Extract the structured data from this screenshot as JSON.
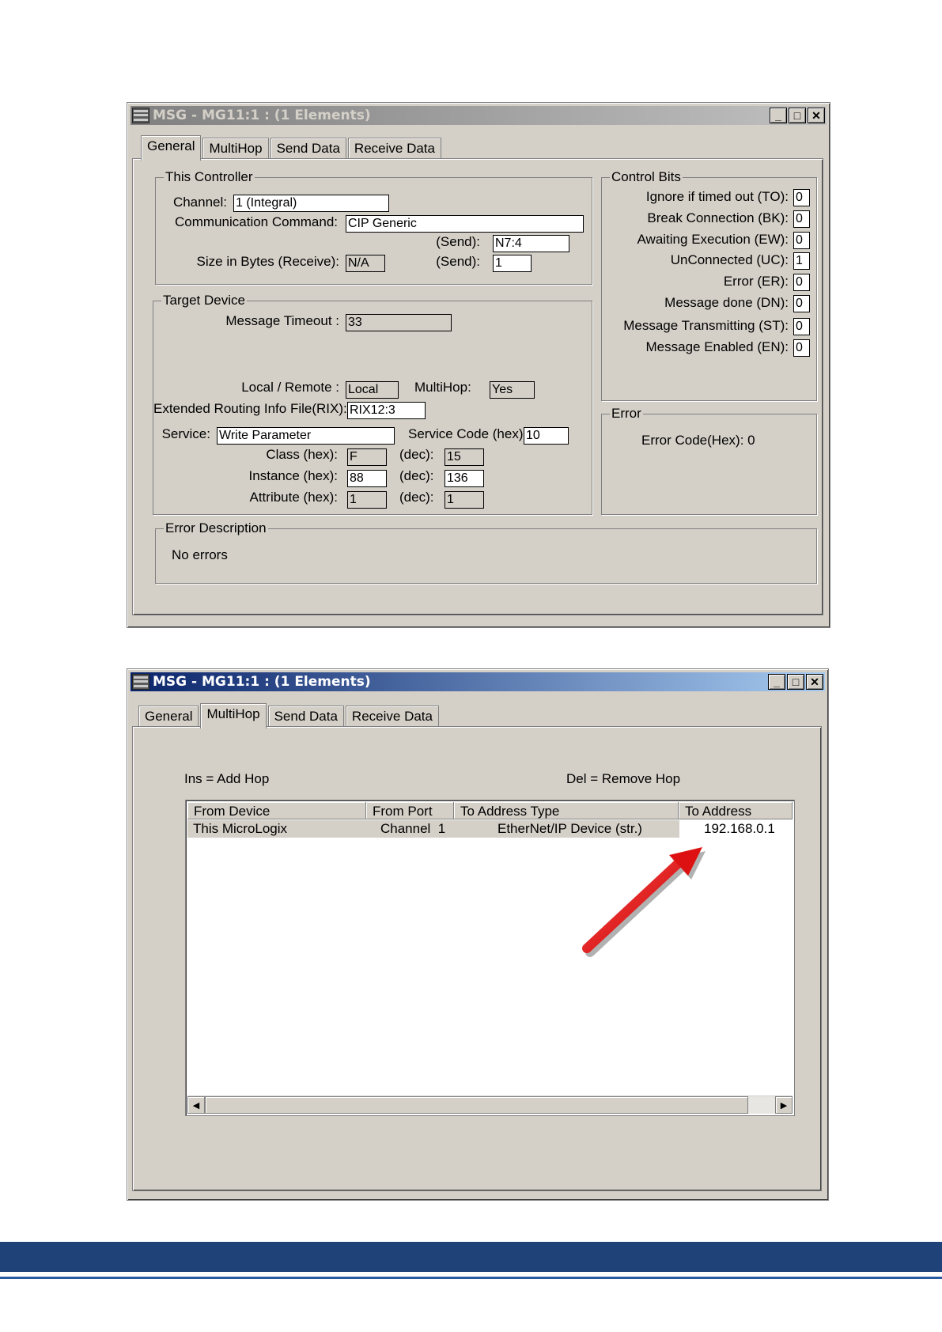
{
  "colors": {
    "footer_band": "#1f4278",
    "footer_line": "#2a5aa0",
    "arrow": "#dd1111"
  },
  "window1": {
    "title": "MSG - MG11:1 : (1 Elements)",
    "tabs": [
      "General",
      "MultiHop",
      "Send Data",
      "Receive Data"
    ],
    "active_tab": "General",
    "this_controller": {
      "legend": "This Controller",
      "channel_label": "Channel:",
      "channel_value": "1 (Integral)",
      "comm_label": "Communication Command:",
      "comm_value": "CIP Generic",
      "send_label": "(Send):",
      "send_value": "N7:4",
      "size_label": "Size in Bytes (Receive):",
      "size_receive": "N/A",
      "size_send_label": "(Send):",
      "size_send_value": "1"
    },
    "target_device": {
      "legend": "Target Device",
      "timeout_label": "Message Timeout :",
      "timeout_value": "33",
      "local_remote_label": "Local / Remote :",
      "local_remote_value": "Local",
      "multihop_label": "MultiHop:",
      "multihop_value": "Yes",
      "rix_label": "Extended Routing Info File(RIX):",
      "rix_value": "RIX12:3",
      "service_label": "Service:",
      "service_value": "Write Parameter",
      "service_code_label": "Service Code (hex):",
      "service_code_value": "10",
      "class_label": "Class (hex):",
      "class_hex": "F",
      "class_dec_label": "(dec):",
      "class_dec": "15",
      "instance_label": "Instance (hex):",
      "instance_hex": "88",
      "instance_dec_label": "(dec):",
      "instance_dec": "136",
      "attribute_label": "Attribute (hex):",
      "attribute_hex": "1",
      "attribute_dec_label": "(dec):",
      "attribute_dec": "1"
    },
    "control_bits": {
      "legend": "Control Bits",
      "items": [
        {
          "label": "Ignore if timed out (TO):",
          "value": "0"
        },
        {
          "label": "Break Connection (BK):",
          "value": "0"
        },
        {
          "label": "Awaiting Execution (EW):",
          "value": "0"
        },
        {
          "label": "UnConnected (UC):",
          "value": "1"
        },
        {
          "label": "Error (ER):",
          "value": "0"
        },
        {
          "label": "Message done (DN):",
          "value": "0"
        },
        {
          "label": "Message Transmitting (ST):",
          "value": "0"
        },
        {
          "label": "Message Enabled (EN):",
          "value": "0"
        }
      ]
    },
    "error": {
      "legend": "Error",
      "code_text": "Error Code(Hex): 0"
    },
    "error_description": {
      "legend": "Error Description",
      "text": "No errors"
    }
  },
  "window2": {
    "title": "MSG - MG11:1 : (1 Elements)",
    "tabs": [
      "General",
      "MultiHop",
      "Send Data",
      "Receive Data"
    ],
    "active_tab": "MultiHop",
    "ins_hint": "Ins = Add Hop",
    "del_hint": "Del = Remove Hop",
    "columns": [
      "From Device",
      "From Port",
      "To Address Type",
      "To Address"
    ],
    "rows": [
      [
        "This MicroLogix",
        "Channel  1",
        "EtherNet/IP Device (str.)",
        "192.168.0.1"
      ]
    ]
  }
}
